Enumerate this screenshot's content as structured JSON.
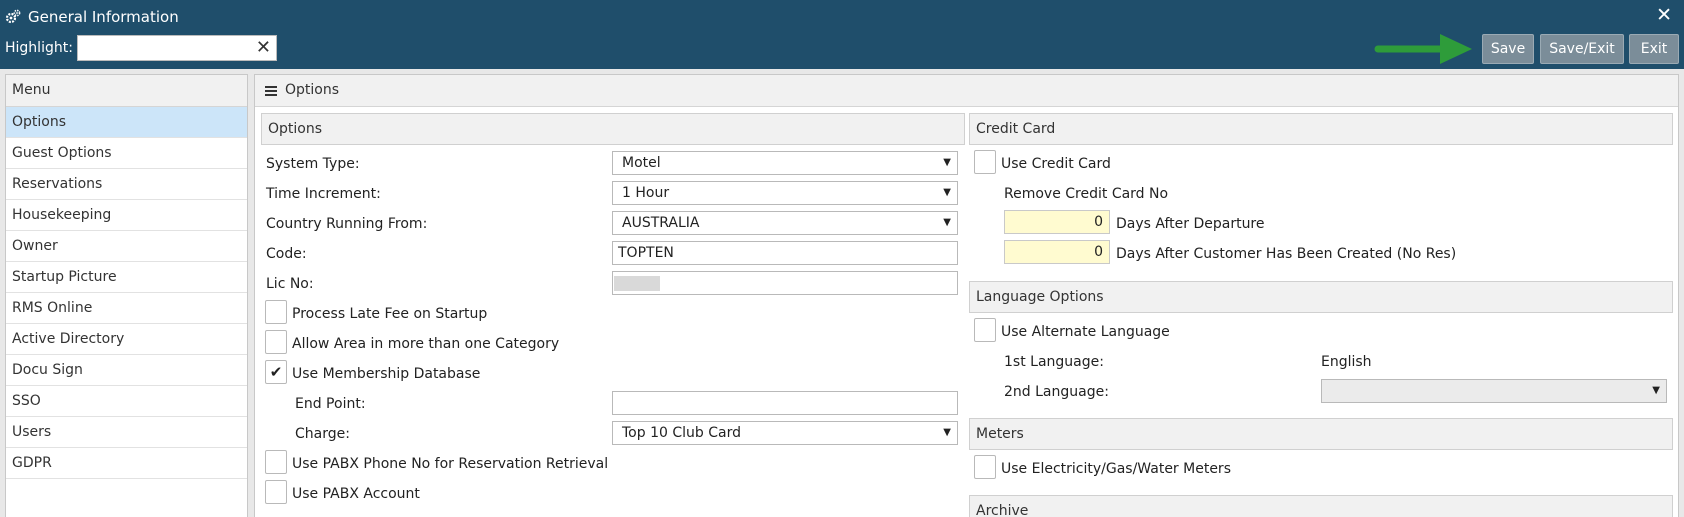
{
  "window": {
    "title": "General Information",
    "title_icon": "gears-icon",
    "close_icon": "close-icon",
    "close_symbol": "✕"
  },
  "toolbar": {
    "highlight_label": "Highlight:",
    "highlight_value": "",
    "clear_symbol": "✕",
    "save_label": "Save",
    "save_exit_label": "Save/Exit",
    "exit_label": "Exit",
    "arrow_color": "#2e9c3a"
  },
  "menu": {
    "header": "Menu",
    "items": [
      "Options",
      "Guest Options",
      "Reservations",
      "Housekeeping",
      "Owner",
      "Startup Picture",
      "RMS Online",
      "Active Directory",
      "Docu Sign",
      "SSO",
      "Users",
      "GDPR"
    ],
    "active": "Options"
  },
  "content": {
    "header": "Options",
    "options": {
      "title": "Options",
      "system_type_label": "System Type:",
      "system_type_value": "Motel",
      "time_increment_label": "Time Increment:",
      "time_increment_value": "1 Hour",
      "country_label": "Country Running From:",
      "country_value": "AUSTRALIA",
      "code_label": "Code:",
      "code_value": "TOPTEN",
      "lic_no_label": "Lic No:",
      "process_late_fee_label": "Process Late Fee on Startup",
      "process_late_fee_checked": false,
      "allow_area_label": "Allow Area in more than one Category",
      "allow_area_checked": false,
      "use_membership_label": "Use Membership Database",
      "use_membership_checked": true,
      "end_point_label": "End Point:",
      "end_point_value": "",
      "charge_label": "Charge:",
      "charge_value": "Top 10 Club Card",
      "pabx_phone_label": "Use PABX Phone No for Reservation Retrieval",
      "pabx_phone_checked": false,
      "pabx_account_label": "Use PABX Account",
      "pabx_account_checked": false,
      "check_symbol": "✔"
    },
    "credit_card": {
      "title": "Credit Card",
      "use_credit_card_label": "Use Credit Card",
      "use_credit_card_checked": false,
      "remove_label": "Remove Credit Card No",
      "days_after_departure_value": "0",
      "days_after_departure_label": "Days After Departure",
      "days_after_created_value": "0",
      "days_after_created_label": "Days After Customer Has Been Created (No Res)"
    },
    "language": {
      "title": "Language Options",
      "use_alt_label": "Use Alternate Language",
      "use_alt_checked": false,
      "first_label": "1st Language:",
      "first_value": "English",
      "second_label": "2nd Language:",
      "second_value": ""
    },
    "meters": {
      "title": "Meters",
      "use_meters_label": "Use Electricity/Gas/Water Meters",
      "use_meters_checked": false
    },
    "archive": {
      "title": "Archive"
    }
  }
}
